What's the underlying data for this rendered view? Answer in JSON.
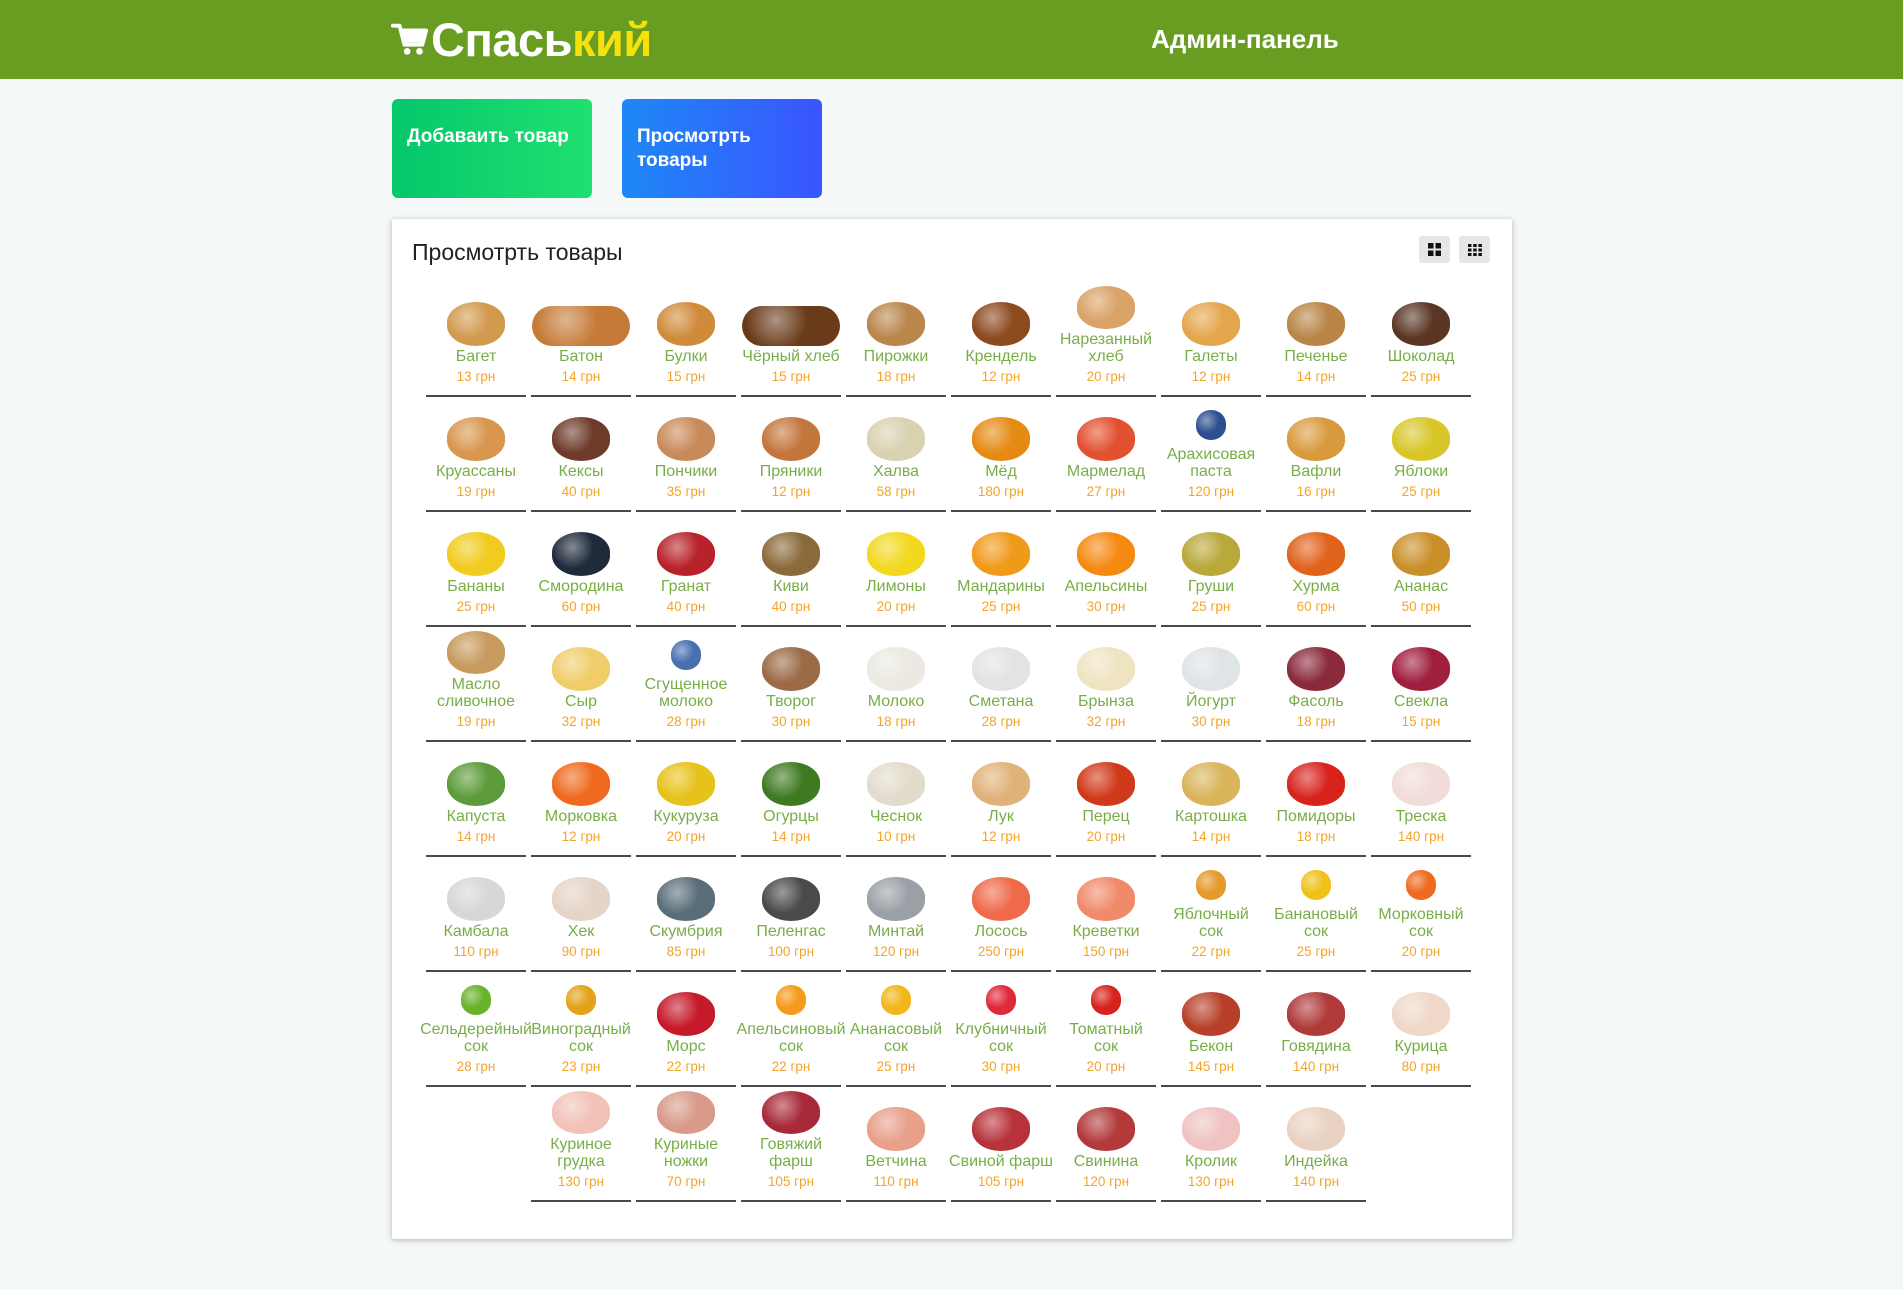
{
  "brand": {
    "part1": "Спась",
    "part2": "кий"
  },
  "admin_title": "Админ-панель",
  "tiles": {
    "add": "Добаваить товар",
    "view": "Просмотрть товары"
  },
  "panel": {
    "title": "Просмотрть товары"
  },
  "colors": {
    "header": "#689d21",
    "accent": "#f6e10d",
    "item_name": "#79ad48",
    "price": "#f3a42a"
  },
  "icons": {
    "cart": "cart-icon",
    "large_grid": "large-grid-icon",
    "small_grid": "small-grid-icon"
  },
  "products": [
    {
      "name": "Багет",
      "price": "13 грн",
      "color": "#d29a4e"
    },
    {
      "name": "Батон",
      "price": "14 грн",
      "color": "#c57b37"
    },
    {
      "name": "Булки",
      "price": "15 грн",
      "color": "#d08b3a"
    },
    {
      "name": "Чёрный хлеб",
      "price": "15 грн",
      "color": "#6a3b1a"
    },
    {
      "name": "Пирожки",
      "price": "18 грн",
      "color": "#b9864b"
    },
    {
      "name": "Крендель",
      "price": "12 грн",
      "color": "#8d4a1f"
    },
    {
      "name": "Нарезанный хлеб",
      "price": "20 грн",
      "color": "#d9a266"
    },
    {
      "name": "Галеты",
      "price": "12 грн",
      "color": "#e4a64c"
    },
    {
      "name": "Печенье",
      "price": "14 грн",
      "color": "#b88547"
    },
    {
      "name": "Шоколад",
      "price": "25 грн",
      "color": "#5b3624"
    },
    {
      "name": "Круассаны",
      "price": "19 грн",
      "color": "#d8964e"
    },
    {
      "name": "Кексы",
      "price": "40 грн",
      "color": "#6e3b2a"
    },
    {
      "name": "Пончики",
      "price": "35 грн",
      "color": "#c98a5a"
    },
    {
      "name": "Пряники",
      "price": "12 грн",
      "color": "#c3763c"
    },
    {
      "name": "Халва",
      "price": "58 грн",
      "color": "#d8d2b0"
    },
    {
      "name": "Мёд",
      "price": "180 грн",
      "color": "#e58b14"
    },
    {
      "name": "Мармелад",
      "price": "27 грн",
      "color": "#e2502f"
    },
    {
      "name": "Арахисовая паста",
      "price": "120 грн",
      "color": "#2e4f8f"
    },
    {
      "name": "Вафли",
      "price": "16 грн",
      "color": "#d99a3e"
    },
    {
      "name": "Яблоки",
      "price": "25 грн",
      "color": "#d9c62a"
    },
    {
      "name": "Бананы",
      "price": "25 грн",
      "color": "#f1cb1f"
    },
    {
      "name": "Смородина",
      "price": "60 грн",
      "color": "#1f2a3a"
    },
    {
      "name": "Гранат",
      "price": "40 грн",
      "color": "#b8222a"
    },
    {
      "name": "Киви",
      "price": "40 грн",
      "color": "#8a6a3a"
    },
    {
      "name": "Лимоны",
      "price": "20 грн",
      "color": "#f2d91f"
    },
    {
      "name": "Мандарины",
      "price": "25 грн",
      "color": "#f09a1a"
    },
    {
      "name": "Апельсины",
      "price": "30 грн",
      "color": "#f58a13"
    },
    {
      "name": "Груши",
      "price": "25 грн",
      "color": "#b9a83a"
    },
    {
      "name": "Хурма",
      "price": "60 грн",
      "color": "#e0631c"
    },
    {
      "name": "Ананас",
      "price": "50 грн",
      "color": "#c9902a"
    },
    {
      "name": "Масло сливочное",
      "price": "19 грн",
      "color": "#c79a5e"
    },
    {
      "name": "Сыр",
      "price": "32 грн",
      "color": "#efce6a"
    },
    {
      "name": "Сгущенное молоко",
      "price": "28 грн",
      "color": "#4a6fb0"
    },
    {
      "name": "Творог",
      "price": "30 грн",
      "color": "#9b6a46"
    },
    {
      "name": "Молоко",
      "price": "18 грн",
      "color": "#ece9e2"
    },
    {
      "name": "Сметана",
      "price": "28 грн",
      "color": "#e3e3e3"
    },
    {
      "name": "Брынза",
      "price": "32 грн",
      "color": "#efe4c2"
    },
    {
      "name": "Йогурт",
      "price": "30 грн",
      "color": "#dfe4e6"
    },
    {
      "name": "Фасоль",
      "price": "18 грн",
      "color": "#8a2a3a"
    },
    {
      "name": "Свекла",
      "price": "15 грн",
      "color": "#a01e3e"
    },
    {
      "name": "Капуста",
      "price": "14 грн",
      "color": "#5c9a3a"
    },
    {
      "name": "Морковка",
      "price": "12 грн",
      "color": "#ef6a1f"
    },
    {
      "name": "Кукуруза",
      "price": "20 грн",
      "color": "#e6c21a"
    },
    {
      "name": "Огурцы",
      "price": "14 грн",
      "color": "#3e7a22"
    },
    {
      "name": "Чеснок",
      "price": "10 грн",
      "color": "#e2dccc"
    },
    {
      "name": "Лук",
      "price": "12 грн",
      "color": "#e0b27a"
    },
    {
      "name": "Перец",
      "price": "20 грн",
      "color": "#d03a1a"
    },
    {
      "name": "Картошка",
      "price": "14 грн",
      "color": "#d9b45a"
    },
    {
      "name": "Помидоры",
      "price": "18 грн",
      "color": "#d8231d"
    },
    {
      "name": "Треска",
      "price": "140 грн",
      "color": "#f2dcd9"
    },
    {
      "name": "Камбала",
      "price": "110 грн",
      "color": "#d7d7d7"
    },
    {
      "name": "Хек",
      "price": "90 грн",
      "color": "#e5d4c8"
    },
    {
      "name": "Скумбрия",
      "price": "85 грн",
      "color": "#5a6e7a"
    },
    {
      "name": "Пеленгас",
      "price": "100 грн",
      "color": "#4a4a48"
    },
    {
      "name": "Минтай",
      "price": "120 грн",
      "color": "#9aa0a6"
    },
    {
      "name": "Лосось",
      "price": "250 грн",
      "color": "#ef6a4a"
    },
    {
      "name": "Креветки",
      "price": "150 грн",
      "color": "#f08a6a"
    },
    {
      "name": "Яблочный сок",
      "price": "22 грн",
      "color": "#e59a2a"
    },
    {
      "name": "Банановый сок",
      "price": "25 грн",
      "color": "#efc21a"
    },
    {
      "name": "Морковный сок",
      "price": "20 грн",
      "color": "#ef6a1f"
    },
    {
      "name": "Сельдерейный сок",
      "price": "28 грн",
      "color": "#6ab22a"
    },
    {
      "name": "Виноградный сок",
      "price": "23 грн",
      "color": "#e3a21a"
    },
    {
      "name": "Морс",
      "price": "22 грн",
      "color": "#c51a2a"
    },
    {
      "name": "Апельсиновый сок",
      "price": "22 грн",
      "color": "#f59a1a"
    },
    {
      "name": "Ананасовый сок",
      "price": "25 грн",
      "color": "#f2b61a"
    },
    {
      "name": "Клубничный сок",
      "price": "30 грн",
      "color": "#e02a3a"
    },
    {
      "name": "Томатный сок",
      "price": "20 грн",
      "color": "#d8231d"
    },
    {
      "name": "Бекон",
      "price": "145 грн",
      "color": "#b8402a"
    },
    {
      "name": "Говядина",
      "price": "140 грн",
      "color": "#b03a3a"
    },
    {
      "name": "Курица",
      "price": "80 грн",
      "color": "#efd8c8"
    },
    {
      "name": "Куриное грудка",
      "price": "130 грн",
      "color": "#f2c2b8"
    },
    {
      "name": "Куриные ножки",
      "price": "70 грн",
      "color": "#d89a8a"
    },
    {
      "name": "Говяжий фарш",
      "price": "105 грн",
      "color": "#a82a3a"
    },
    {
      "name": "Ветчина",
      "price": "110 грн",
      "color": "#e8a08a"
    },
    {
      "name": "Свиной фарш",
      "price": "105 грн",
      "color": "#b8323a"
    },
    {
      "name": "Свинина",
      "price": "120 грн",
      "color": "#b23a3a"
    },
    {
      "name": "Кролик",
      "price": "130 грн",
      "color": "#f0c2c2"
    },
    {
      "name": "Индейка",
      "price": "140 грн",
      "color": "#ead2c2"
    }
  ]
}
